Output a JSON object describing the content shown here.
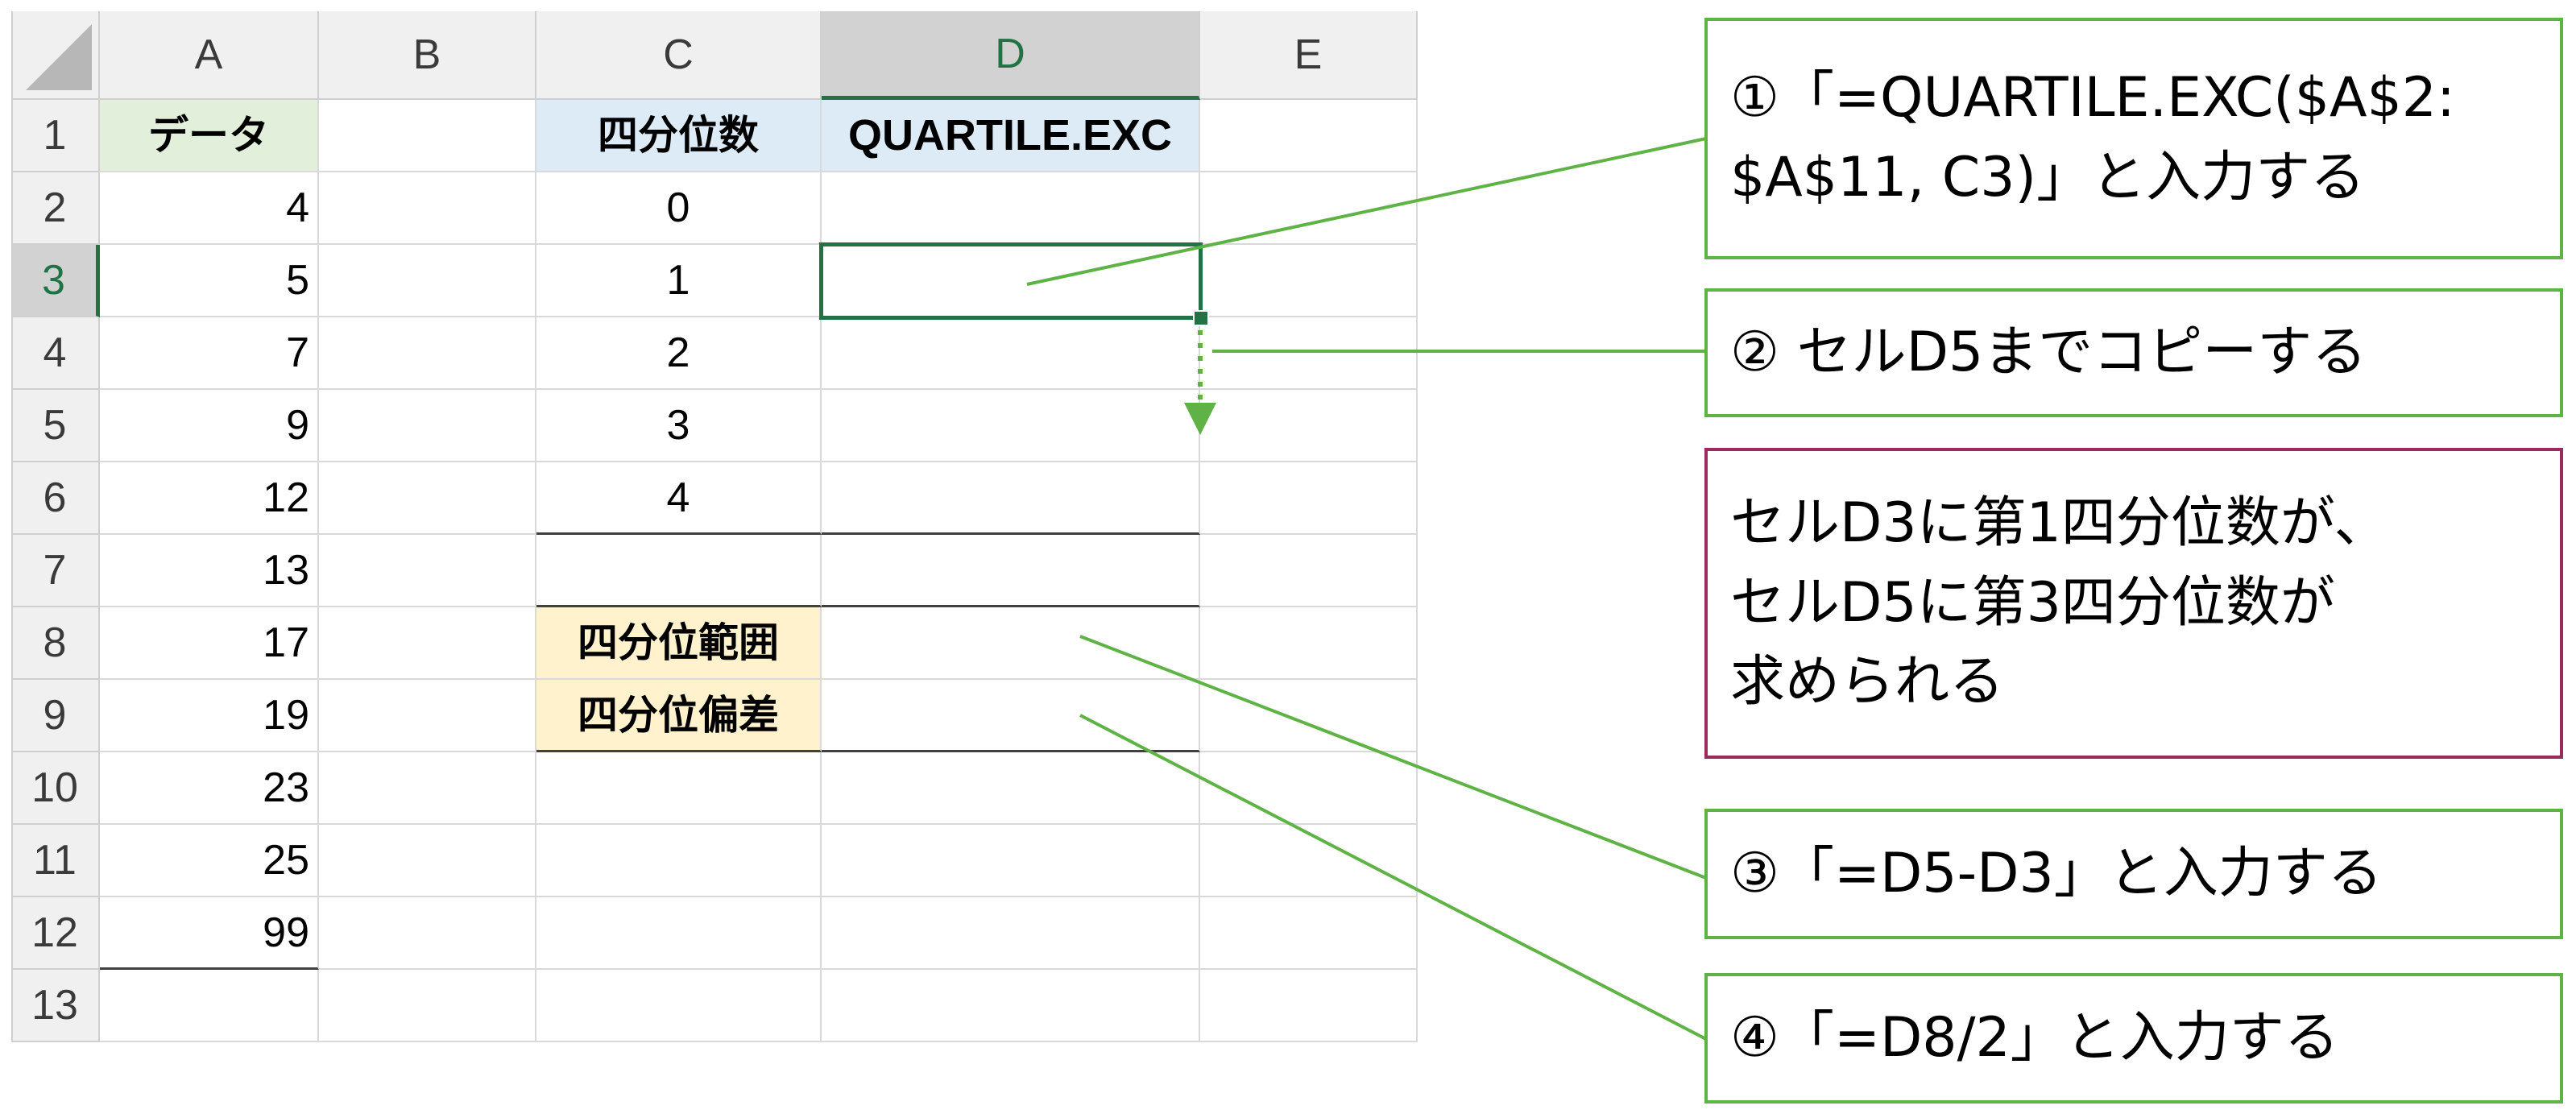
{
  "columns": [
    "A",
    "B",
    "C",
    "D",
    "E"
  ],
  "selected_column": "D",
  "rows": [
    "1",
    "2",
    "3",
    "4",
    "5",
    "6",
    "7",
    "8",
    "9",
    "10",
    "11",
    "12",
    "13"
  ],
  "selected_row": "3",
  "cells": {
    "A1": "データ",
    "A2": "4",
    "A3": "5",
    "A4": "7",
    "A5": "9",
    "A6": "12",
    "A7": "13",
    "A8": "17",
    "A9": "19",
    "A10": "23",
    "A11": "25",
    "A12": "99",
    "C1": "四分位数",
    "D1": "QUARTILE.EXC",
    "C2": "0",
    "C3": "1",
    "C4": "2",
    "C5": "3",
    "C6": "4",
    "C8": "四分位範囲",
    "C9": "四分位偏差"
  },
  "active_cell": "D3",
  "callouts": [
    {
      "lines": [
        "①「=QUARTILE.EXC($A$2:",
        "$A$11, C3)」と入力する"
      ]
    },
    {
      "lines": [
        "② セルD5までコピーする"
      ]
    },
    {
      "lines": [
        "セルD3に第1四分位数が、",
        "セルD5に第3四分位数が",
        "求められる"
      ]
    },
    {
      "lines": [
        "③「=D5-D3」と入力する"
      ]
    },
    {
      "lines": [
        "④「=D8/2」と入力する"
      ]
    }
  ],
  "colors": {
    "accent_green": "#5fb246",
    "selection_green": "#217346",
    "note_border": "#9b2a5e",
    "header_green_fill": "#e2efda",
    "header_blue_fill": "#ddebf7",
    "header_yellow_fill": "#fff2cc"
  },
  "icons": [
    "select-all-corner-icon",
    "fill-arrow-icon"
  ]
}
